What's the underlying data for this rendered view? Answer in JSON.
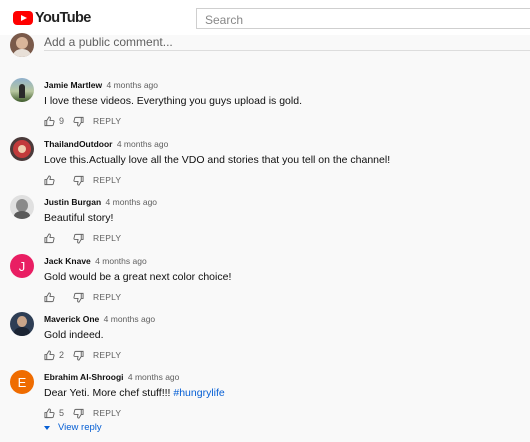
{
  "header": {
    "logo_text": "YouTube",
    "search_placeholder": "Search"
  },
  "add_comment": {
    "placeholder": "Add a public comment..."
  },
  "comments": [
    {
      "author": "Jamie Martlew",
      "time": "4 months ago",
      "text": "I love these videos. Everything you guys upload is gold.",
      "likes": "9",
      "reply_label": "REPLY",
      "avatar": "photo"
    },
    {
      "author": "ThailandOutdoor",
      "time": "4 months ago",
      "text": "Love this.Actually love all the VDO and stories that you tell on the channel!",
      "likes": "",
      "reply_label": "REPLY",
      "avatar": "photo"
    },
    {
      "author": "Justin Burgan",
      "time": "4 months ago",
      "text": "Beautiful story!",
      "likes": "",
      "reply_label": "REPLY",
      "avatar": "photo"
    },
    {
      "author": "Jack Knave",
      "time": "4 months ago",
      "text": "Gold would be a great next color choice!",
      "likes": "",
      "reply_label": "REPLY",
      "avatar": "J",
      "avatar_color": "#e91e63"
    },
    {
      "author": "Maverick One",
      "time": "4 months ago",
      "text": "Gold indeed.",
      "likes": "2",
      "reply_label": "REPLY",
      "avatar": "photo"
    },
    {
      "author": "Ebrahim Al-Shroogi",
      "time": "4 months ago",
      "text": "Dear Yeti. More chef stuff!!! ",
      "hashtag": "#hungrylife",
      "likes": "5",
      "reply_label": "REPLY",
      "avatar": "E",
      "avatar_color": "#ef6c00"
    }
  ],
  "view_reply": "View reply",
  "icons": {
    "like": "thumbs-up-icon",
    "dislike": "thumbs-down-icon",
    "expand": "chevron-down-icon"
  }
}
